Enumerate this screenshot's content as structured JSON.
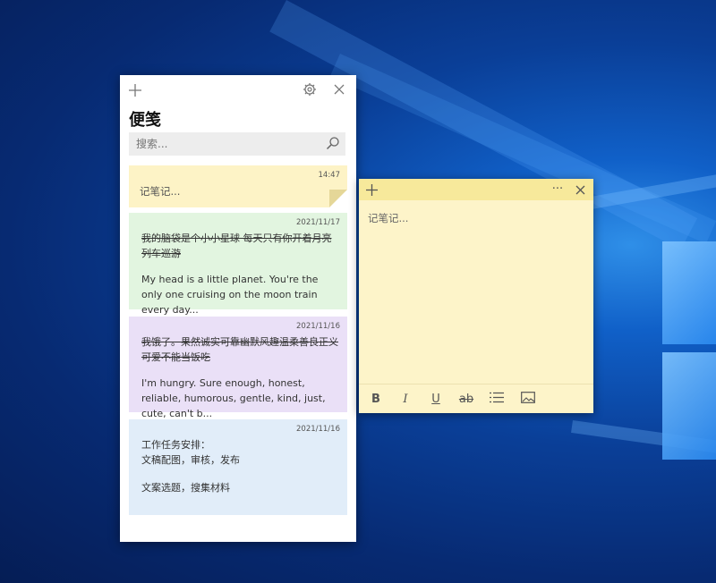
{
  "notes_list": {
    "title": "便笺",
    "search_placeholder": "搜索...",
    "icons": [
      "plus-icon",
      "gear-icon",
      "close-icon",
      "search-icon"
    ],
    "notes": [
      {
        "date": "14:47",
        "text": "记笔记...",
        "color": "#fdf3c6"
      },
      {
        "date": "2021/11/17",
        "strike_text": "我的脑袋是个小小星球 每天只有你开着月亮列车巡游",
        "body": "My head is a little planet. You're the only one cruising on the moon train every day...",
        "color": "#e2f5e0"
      },
      {
        "date": "2021/11/16",
        "strike_text": "我饿了。果然诚实可靠幽默风趣温柔善良正义可爱不能当饭吃",
        "body": "I'm hungry. Sure enough, honest, reliable, humorous, gentle, kind, just, cute, can't b...",
        "color": "#eae0f7"
      },
      {
        "date": "2021/11/16",
        "line1": "工作任务安排：",
        "line2": "文稿配图，审核，发布",
        "line3": "文案选题，搜集材料",
        "color": "#e1edf9"
      }
    ]
  },
  "note_window": {
    "placeholder": "记笔记...",
    "menu_label": "···",
    "icons": [
      "plus-icon",
      "more-icon",
      "close-icon"
    ],
    "toolbar": [
      {
        "name": "bold-button",
        "label": "B"
      },
      {
        "name": "italic-button",
        "label": "I"
      },
      {
        "name": "underline-button",
        "label": "U"
      },
      {
        "name": "strikethrough-button",
        "label": "ab"
      },
      {
        "name": "bullet-list-button",
        "icon": "list-icon"
      },
      {
        "name": "add-image-button",
        "icon": "image-icon"
      }
    ],
    "colors": {
      "body": "#fdf4c9",
      "header": "#f7e99b"
    }
  }
}
